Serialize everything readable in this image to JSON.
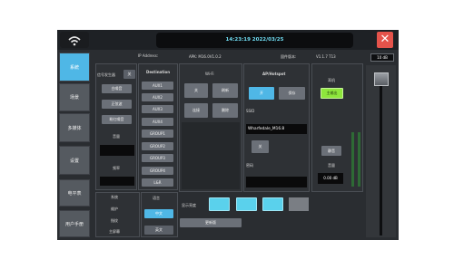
{
  "header": {
    "datetime": "14:23:19 2022/03/25",
    "ip_label": "IP Address:",
    "apk_label": "APK: M16.0V1.0.2",
    "firmware_label": "固件版本:",
    "firmware_value": "V1.1.7 T13",
    "db_readout": "10 dB"
  },
  "sidebar": {
    "items": [
      {
        "label": "系統"
      },
      {
        "label": "场景"
      },
      {
        "label": "多媒体"
      },
      {
        "label": "设置"
      },
      {
        "label": "电平表"
      },
      {
        "label": "用户手册"
      }
    ]
  },
  "signal": {
    "label": "信号发生器",
    "toggle": "关",
    "types": [
      "白噪音",
      "正弦波",
      "粉红噪音"
    ],
    "volume_label": "音量",
    "freq_label": "频率"
  },
  "destination": {
    "title": "Destination",
    "items": [
      "AUX1",
      "AUX2",
      "AUX3",
      "AUX4",
      "GROUP1",
      "GROUP2",
      "GROUP3",
      "GROUP4",
      "L&R"
    ]
  },
  "wifi": {
    "title": "Wi-Fi",
    "off": "关",
    "refresh": "刷新",
    "connect": "连接",
    "delete": "删除"
  },
  "ap": {
    "title": "AP/Hotspot",
    "on": "开",
    "save": "保存",
    "ssid_label": "SSID",
    "ssid_value": "Wharfedale_M16.8",
    "off": "关",
    "password_label": "密码"
  },
  "headphone": {
    "title": "耳机",
    "source": "主输出",
    "mute": "静音",
    "volume_label": "音量",
    "volume_value": "0.00 dB"
  },
  "bottom": {
    "menu": [
      "系统",
      "维护",
      "指纹",
      "主屏幕"
    ],
    "language_label": "语言",
    "languages": [
      "中文",
      "英文"
    ],
    "brightness_label": "显示亮度",
    "update": "更新版"
  }
}
